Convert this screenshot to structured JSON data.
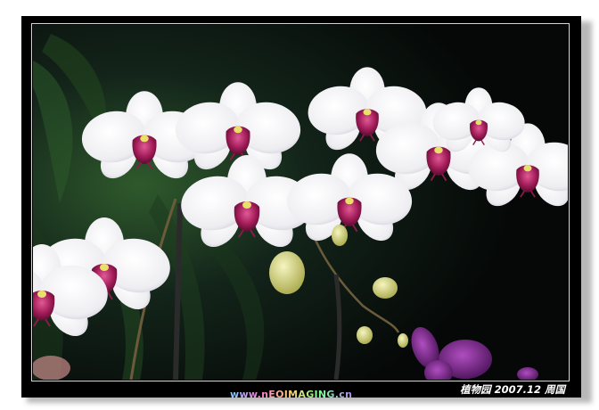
{
  "photo": {
    "subject-icon": "orchid-photo",
    "watermark": "www.nEOIMAGING.cn",
    "caption": "植物园 2007.12 周国"
  },
  "colors": {
    "frame": "#000000",
    "petal": "#f4f4f6",
    "lip": "#a0205a",
    "foliage": "#1f3a22",
    "bud": "#d6d68a"
  }
}
